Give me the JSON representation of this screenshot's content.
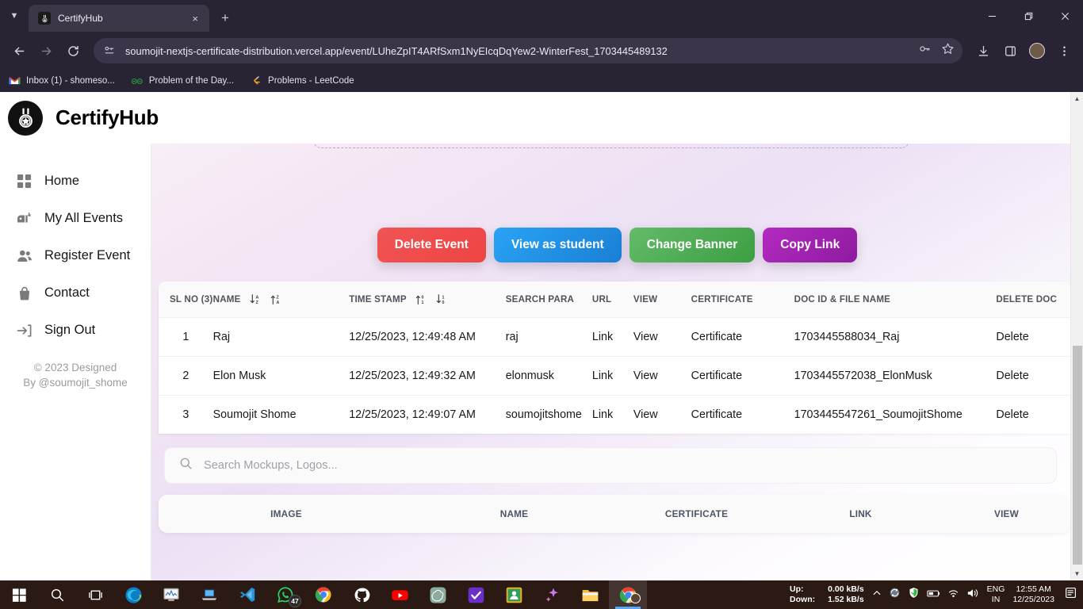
{
  "browser": {
    "tab": {
      "title": "CertifyHub",
      "favicon": "medal-icon",
      "close": "×"
    },
    "new_tab": "+",
    "window_controls": {
      "minimize": "minimize-icon",
      "maximize": "restore-icon",
      "close": "close-icon"
    },
    "nav": {
      "back": "←",
      "forward": "→",
      "reload": "↻"
    },
    "url": "soumojit-nextjs-certificate-distribution.vercel.app/event/LUheZpIT4ARfSxm1NyEIcqDqYew2-WinterFest_1703445489132",
    "omni_icons": [
      "site-info-icon",
      "password-key-icon",
      "bookmark-star-icon"
    ],
    "toolbar_icons": [
      "download-icon",
      "side-panel-icon",
      "profile-avatar-icon",
      "more-menu-icon"
    ],
    "bookmarks": [
      {
        "label": "Inbox (1) - shomeso...",
        "icon": "gmail-icon",
        "glyph": "M",
        "color": "#ea4335"
      },
      {
        "label": "Problem of the Day...",
        "icon": "geeksforgeeks-icon",
        "glyph": "GG",
        "color": "#2f8d46"
      },
      {
        "label": "Problems - LeetCode",
        "icon": "leetcode-icon",
        "glyph": "⑂",
        "color": "#ffa116"
      }
    ]
  },
  "app": {
    "brand": "CertifyHub",
    "logo": "medal-badge-icon",
    "sidebar": {
      "items": [
        {
          "label": "Home",
          "icon": "grid-dashboard-icon"
        },
        {
          "label": "My All Events",
          "icon": "mailbox-icon"
        },
        {
          "label": "Register Event",
          "icon": "users-icon"
        },
        {
          "label": "Contact",
          "icon": "shopping-bag-icon"
        },
        {
          "label": "Sign Out",
          "icon": "logout-icon"
        }
      ],
      "copyright_line1": "© 2023 Designed",
      "copyright_line2": "By @soumojit_shome"
    },
    "actions": [
      {
        "label": "Delete Event",
        "name": "delete-event-button",
        "color": "#ef4444"
      },
      {
        "label": "View as student",
        "name": "view-as-student-button",
        "color": "#2196f3"
      },
      {
        "label": "Change Banner",
        "name": "change-banner-button",
        "color": "#4caf50"
      },
      {
        "label": "Copy Link",
        "name": "copy-link-button",
        "color": "#a020b0"
      }
    ],
    "participants_table": {
      "headers": {
        "sl_no": "SL NO (3)",
        "name": "NAME",
        "time_stamp": "TIME STAMP",
        "search_para": "SEARCH PARA",
        "url": "URL",
        "view": "VIEW",
        "certificate": "CERTIFICATE",
        "doc_id": "DOC ID & FILE NAME",
        "delete_doc": "DELETE DOC"
      },
      "sort_icons": {
        "name_asc": "arrow-down-a-z-icon",
        "name_desc": "arrow-up-z-a-icon",
        "time_asc": "arrow-up-0-1-icon",
        "time_desc": "arrow-down-1-0-icon"
      },
      "rows": [
        {
          "sl": "1",
          "name": "Raj",
          "timestamp": "12/25/2023, 12:49:48 AM",
          "search_para": "raj",
          "url": "Link",
          "view": "View",
          "certificate": "Certificate",
          "doc_id": "1703445588034_Raj",
          "delete": "Delete"
        },
        {
          "sl": "2",
          "name": "Elon Musk",
          "timestamp": "12/25/2023, 12:49:32 AM",
          "search_para": "elonmusk",
          "url": "Link",
          "view": "View",
          "certificate": "Certificate",
          "doc_id": "1703445572038_ElonMusk",
          "delete": "Delete"
        },
        {
          "sl": "3",
          "name": "Soumojit Shome",
          "timestamp": "12/25/2023, 12:49:07 AM",
          "search_para": "soumojitshome",
          "url": "Link",
          "view": "View",
          "certificate": "Certificate",
          "doc_id": "1703445547261_SoumojitShome",
          "delete": "Delete"
        }
      ]
    },
    "search": {
      "placeholder": "Search Mockups, Logos...",
      "value": "",
      "icon": "search-icon"
    },
    "mockups_table": {
      "headers": {
        "image": "IMAGE",
        "name": "NAME",
        "certificate": "CERTIFICATE",
        "link": "LINK",
        "view": "VIEW"
      },
      "rows": []
    }
  },
  "taskbar": {
    "items": [
      {
        "name": "start-button",
        "icon": "windows-icon"
      },
      {
        "name": "search-button",
        "icon": "search-icon"
      },
      {
        "name": "task-view-button",
        "icon": "task-view-icon"
      },
      {
        "name": "edge-app",
        "icon": "edge-icon"
      },
      {
        "name": "system-monitor-app",
        "icon": "monitor-icon"
      },
      {
        "name": "remote-desktop-app",
        "icon": "laptop-icon"
      },
      {
        "name": "vscode-app",
        "icon": "vscode-icon"
      },
      {
        "name": "whatsapp-app",
        "icon": "whatsapp-icon",
        "badge": "47"
      },
      {
        "name": "chrome-app",
        "icon": "chrome-icon"
      },
      {
        "name": "github-app",
        "icon": "github-icon"
      },
      {
        "name": "youtube-app",
        "icon": "youtube-icon"
      },
      {
        "name": "chatgpt-app",
        "icon": "chatgpt-icon"
      },
      {
        "name": "todo-app",
        "icon": "checkmark-icon"
      },
      {
        "name": "contacts-app",
        "icon": "contacts-icon"
      },
      {
        "name": "copilot-app",
        "icon": "copilot-sparkle-icon"
      },
      {
        "name": "file-explorer-app",
        "icon": "folder-icon"
      },
      {
        "name": "chrome-window",
        "icon": "chrome-profile-icon"
      }
    ],
    "net": {
      "up_label": "Up:",
      "up_value": "0.00 kB/s",
      "down_label": "Down:",
      "down_value": "1.52 kB/s"
    },
    "tray_icons": [
      "chevron-up-icon",
      "network-sync-icon",
      "shield-icon",
      "battery-icon",
      "wifi-icon",
      "volume-icon"
    ],
    "language_line1": "ENG",
    "language_line2": "IN",
    "time": "12:55 AM",
    "date": "12/25/2023",
    "notification": "notification-icon"
  }
}
